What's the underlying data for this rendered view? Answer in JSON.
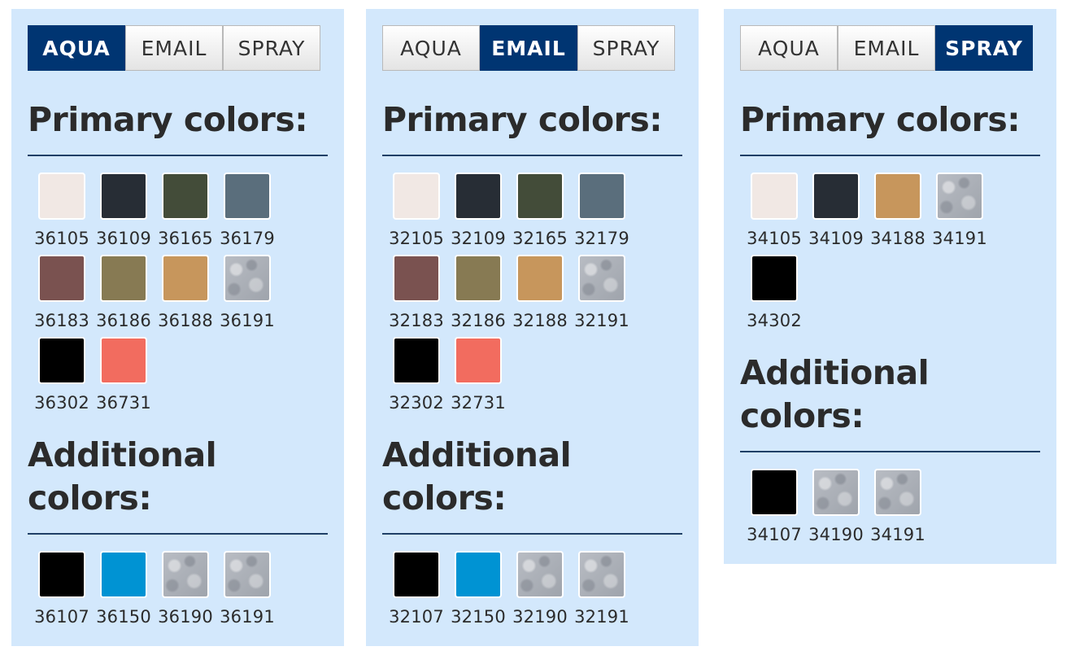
{
  "panels": [
    {
      "tabs": [
        "AQUA",
        "EMAIL",
        "SPRAY"
      ],
      "active_tab": 0,
      "primary_heading": "Primary colors:",
      "additional_heading": "Additional colors:",
      "primary": [
        {
          "code": "36105",
          "color": "#f1e8e4",
          "texture": "solid"
        },
        {
          "code": "36109",
          "color": "#272d35",
          "texture": "solid"
        },
        {
          "code": "36165",
          "color": "#434c39",
          "texture": "solid"
        },
        {
          "code": "36179",
          "color": "#5a6e7c",
          "texture": "solid"
        },
        {
          "code": "36183",
          "color": "#7a5250",
          "texture": "solid"
        },
        {
          "code": "36186",
          "color": "#877a53",
          "texture": "solid"
        },
        {
          "code": "36188",
          "color": "#c7965c",
          "texture": "solid"
        },
        {
          "code": "36191",
          "color": "#a9adb5",
          "texture": "metallic"
        },
        {
          "code": "36302",
          "color": "#000000",
          "texture": "solid"
        },
        {
          "code": "36731",
          "color": "#f26c5f",
          "texture": "solid"
        }
      ],
      "additional": [
        {
          "code": "36107",
          "color": "#000000",
          "texture": "solid"
        },
        {
          "code": "36150",
          "color": "#0093d3",
          "texture": "solid"
        },
        {
          "code": "36190",
          "color": "#b3b8c0",
          "texture": "metallic"
        },
        {
          "code": "36191",
          "color": "#a9adb5",
          "texture": "metallic"
        }
      ]
    },
    {
      "tabs": [
        "AQUA",
        "EMAIL",
        "SPRAY"
      ],
      "active_tab": 1,
      "primary_heading": "Primary colors:",
      "additional_heading": "Additional colors:",
      "primary": [
        {
          "code": "32105",
          "color": "#f1e8e4",
          "texture": "solid"
        },
        {
          "code": "32109",
          "color": "#272d35",
          "texture": "solid"
        },
        {
          "code": "32165",
          "color": "#434c39",
          "texture": "solid"
        },
        {
          "code": "32179",
          "color": "#5a6e7c",
          "texture": "solid"
        },
        {
          "code": "32183",
          "color": "#7a5250",
          "texture": "solid"
        },
        {
          "code": "32186",
          "color": "#877a53",
          "texture": "solid"
        },
        {
          "code": "32188",
          "color": "#c7965c",
          "texture": "solid"
        },
        {
          "code": "32191",
          "color": "#a9adb5",
          "texture": "metallic"
        },
        {
          "code": "32302",
          "color": "#000000",
          "texture": "solid"
        },
        {
          "code": "32731",
          "color": "#f26c5f",
          "texture": "solid"
        }
      ],
      "additional": [
        {
          "code": "32107",
          "color": "#000000",
          "texture": "solid"
        },
        {
          "code": "32150",
          "color": "#0093d3",
          "texture": "solid"
        },
        {
          "code": "32190",
          "color": "#b3b8c0",
          "texture": "metallic"
        },
        {
          "code": "32191",
          "color": "#a9adb5",
          "texture": "metallic"
        }
      ]
    },
    {
      "tabs": [
        "AQUA",
        "EMAIL",
        "SPRAY"
      ],
      "active_tab": 2,
      "primary_heading": "Primary colors:",
      "additional_heading": "Additional colors:",
      "primary": [
        {
          "code": "34105",
          "color": "#f1e8e4",
          "texture": "solid"
        },
        {
          "code": "34109",
          "color": "#272d35",
          "texture": "solid"
        },
        {
          "code": "34188",
          "color": "#c7965c",
          "texture": "solid"
        },
        {
          "code": "34191",
          "color": "#a9adb5",
          "texture": "metallic"
        },
        {
          "code": "34302",
          "color": "#000000",
          "texture": "solid"
        }
      ],
      "additional": [
        {
          "code": "34107",
          "color": "#000000",
          "texture": "solid"
        },
        {
          "code": "34190",
          "color": "#b3b8c0",
          "texture": "metallic"
        },
        {
          "code": "34191",
          "color": "#a9adb5",
          "texture": "metallic"
        }
      ]
    }
  ],
  "colors": {
    "panel_bg": "#d3e8fc",
    "active_tab_bg": "#003572",
    "rule": "#1f3f66",
    "heading_text": "#2b2b2b"
  }
}
